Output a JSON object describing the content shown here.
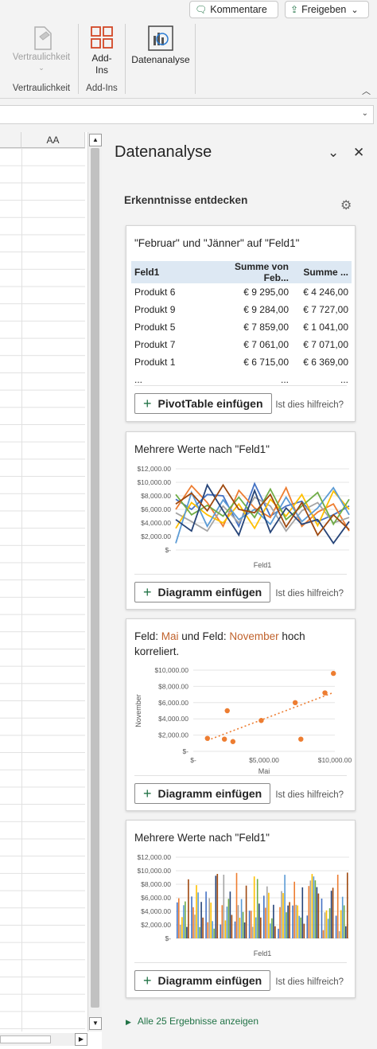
{
  "ribbon": {
    "comments_label": "Kommentare",
    "share_label": "Freigeben",
    "share_caret": "⌄",
    "sensitivity_label": "Vertraulichkeit",
    "sensitivity_group": "Vertraulichkeit",
    "addins_label_1": "Add-",
    "addins_label_2": "Ins",
    "addins_group": "Add-Ins",
    "analyze_label": "Datenanalyse"
  },
  "sheet": {
    "column_header": "AA"
  },
  "pane": {
    "title": "Datenanalyse",
    "section_title": "Erkenntnisse entdecken",
    "show_all": "Alle 25 Ergebnisse anzeigen",
    "helpful": "Ist dies hilfreich?"
  },
  "card1": {
    "title": "\"Februar\" und \"Jänner\" auf \"Feld1\"",
    "columns": [
      "Feld1",
      "Summe von Feb...",
      "Summe ..."
    ],
    "rows": [
      [
        "Produkt 6",
        "€ 9 295,00",
        "€ 4 246,00"
      ],
      [
        "Produkt 9",
        "€ 9 284,00",
        "€ 7 727,00"
      ],
      [
        "Produkt 5",
        "€ 7 859,00",
        "€ 1 041,00"
      ],
      [
        "Produkt 7",
        "€ 7 061,00",
        "€ 7 071,00"
      ],
      [
        "Produkt 1",
        "€ 6 715,00",
        "€ 6 369,00"
      ]
    ],
    "ellipsis": "...",
    "button": "PivotTable einfügen"
  },
  "card2": {
    "title": "Mehrere Werte nach \"Feld1\"",
    "button": "Diagramm einfügen",
    "xlabel": "Feld1"
  },
  "card3": {
    "title_prefix": "Feld: ",
    "title_field1": "Mai",
    "title_mid": " und Feld: ",
    "title_field2": "November",
    "title_suffix": " hoch",
    "title_line2": "korreliert.",
    "button": "Diagramm einfügen",
    "xlabel": "Mai",
    "ylabel": "November"
  },
  "card4": {
    "title": "Mehrere Werte nach \"Feld1\"",
    "button": "Diagramm einfügen",
    "xlabel": "Feld1"
  },
  "chart_data": [
    {
      "type": "line",
      "ylim": [
        0,
        12000
      ],
      "yticks": [
        "$12,000.00",
        "$10,000.00",
        "$8,000.00",
        "$6,000.00",
        "$4,000.00",
        "$2,000.00",
        "$-"
      ],
      "xlabel": "Feld1",
      "series": [
        {
          "color": "#4472c4",
          "values": [
            7500,
            6000,
            8200,
            8000,
            3500,
            9800,
            5000,
            6500,
            7200,
            4200,
            5200,
            6500
          ]
        },
        {
          "color": "#ed7d31",
          "values": [
            6000,
            9500,
            7000,
            3500,
            8800,
            6200,
            4800,
            9200,
            3500,
            5600,
            6800,
            2800
          ]
        },
        {
          "color": "#a5a5a5",
          "values": [
            5500,
            4200,
            2800,
            6500,
            4000,
            7800,
            6500,
            2800,
            5800,
            7000,
            4000,
            4800
          ]
        },
        {
          "color": "#ffc000",
          "values": [
            3200,
            7000,
            5200,
            4000,
            6800,
            3200,
            7500,
            5000,
            8200,
            3600,
            8700,
            6000
          ]
        },
        {
          "color": "#5b9bd5",
          "values": [
            1000,
            8500,
            3500,
            7400,
            4500,
            6000,
            3800,
            7800,
            4200,
            6200,
            9200,
            5200
          ]
        },
        {
          "color": "#70ad47",
          "values": [
            8200,
            5200,
            6600,
            5000,
            7800,
            4800,
            9000,
            4500,
            6500,
            8500,
            3800,
            7500
          ]
        },
        {
          "color": "#264478",
          "values": [
            4500,
            2800,
            9600,
            5800,
            2200,
            8800,
            2600,
            6200,
            3800,
            4500,
            1000,
            4200
          ]
        },
        {
          "color": "#9e480e",
          "values": [
            6800,
            8400,
            5800,
            9600,
            6000,
            5500,
            8200,
            3400,
            7000,
            2200,
            5200,
            3000
          ]
        }
      ]
    },
    {
      "type": "scatter",
      "xlim": [
        0,
        10000
      ],
      "ylim": [
        0,
        10000
      ],
      "xticks": [
        "$-",
        "$5,000.00",
        "$10,000.00"
      ],
      "yticks": [
        "$10,000.00",
        "$8,000.00",
        "$6,000.00",
        "$4,000.00",
        "$2,000.00",
        "$-"
      ],
      "xlabel": "Mai",
      "ylabel": "November",
      "color": "#ed7d31",
      "points": [
        [
          1000,
          1600
        ],
        [
          2200,
          1500
        ],
        [
          2400,
          5000
        ],
        [
          2800,
          1200
        ],
        [
          4800,
          3800
        ],
        [
          7200,
          6000
        ],
        [
          7600,
          1500
        ],
        [
          9300,
          7200
        ],
        [
          9900,
          9600
        ]
      ],
      "trendline": true
    },
    {
      "type": "bar",
      "ylim": [
        0,
        12000
      ],
      "yticks": [
        "$12,000.00",
        "$10,000.00",
        "$8,000.00",
        "$6,000.00",
        "$4,000.00",
        "$2,000.00",
        "$-"
      ],
      "xlabel": "Feld1",
      "groups": 12,
      "colors": [
        "#4472c4",
        "#ed7d31",
        "#a5a5a5",
        "#ffc000",
        "#5b9bd5",
        "#70ad47",
        "#264478",
        "#9e480e"
      ]
    }
  ]
}
